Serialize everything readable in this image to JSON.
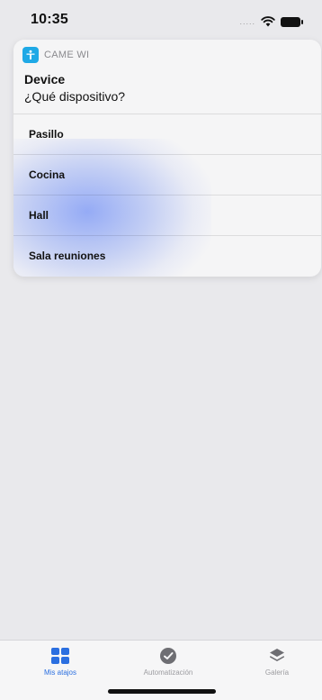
{
  "status_bar": {
    "time": "10:35",
    "signal_text": "....."
  },
  "notification": {
    "app_name": "CAME WI",
    "title": "Device",
    "subtitle": "¿Qué dispositivo?",
    "options": [
      "Pasillo",
      "Cocina",
      "Hall",
      "Sala reuniones"
    ]
  },
  "tab_bar": {
    "tabs": [
      {
        "label": "Mis atajos",
        "active": true
      },
      {
        "label": "Automatización",
        "active": false
      },
      {
        "label": "Galería",
        "active": false
      }
    ]
  },
  "colors": {
    "accent": "#2b6fe0",
    "app_icon": "#1fa9e6"
  }
}
